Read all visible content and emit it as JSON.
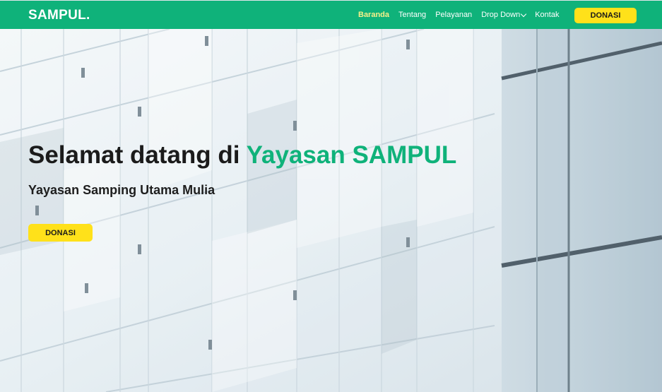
{
  "header": {
    "logo": "SAMPUL.",
    "nav": [
      {
        "label": "Baranda",
        "active": true
      },
      {
        "label": "Tentang",
        "active": false
      },
      {
        "label": "Pelayanan",
        "active": false
      },
      {
        "label": "Drop Down",
        "active": false,
        "icon": "chevron-down-icon"
      },
      {
        "label": "Kontak",
        "active": false
      }
    ],
    "donate_label": "DONASI"
  },
  "hero": {
    "title_prefix": "Selamat datang di ",
    "title_accent": "Yayasan SAMPUL",
    "subtitle": "Yayasan Samping Utama Mulia",
    "donate_label": "DONASI"
  },
  "colors": {
    "brand": "#0fb27a",
    "button": "#ffe11a",
    "active_nav": "#f6f08a"
  }
}
